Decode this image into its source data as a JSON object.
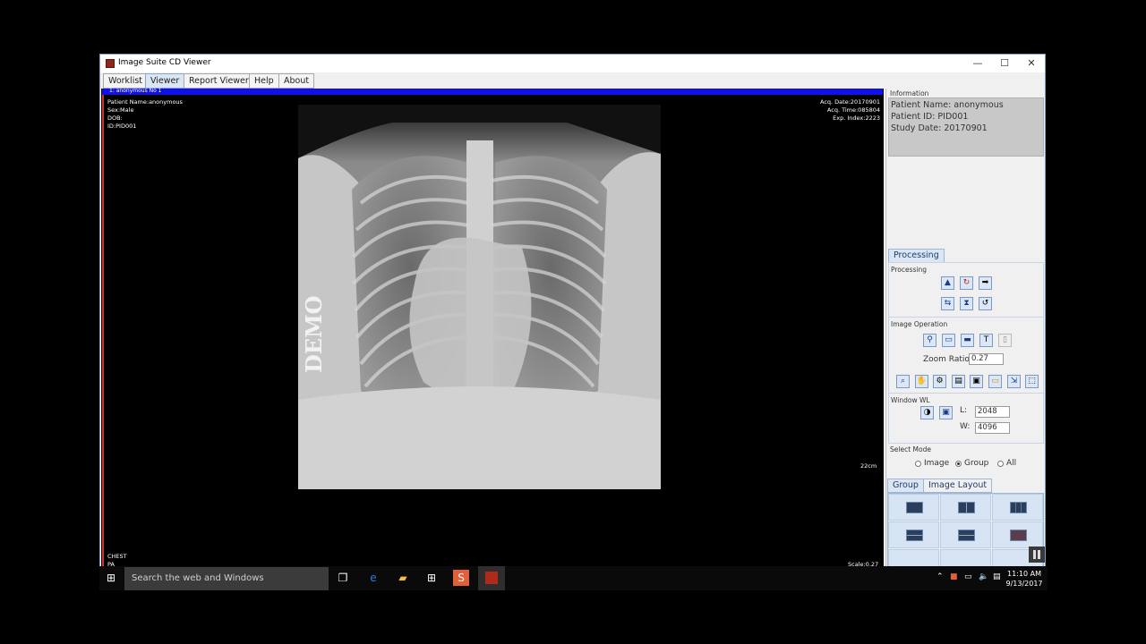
{
  "window": {
    "title": "Image Suite CD Viewer",
    "minimize": "—",
    "maximize": "☐",
    "close": "✕"
  },
  "menu": {
    "items": [
      "Worklist",
      "Viewer",
      "Report Viewer",
      "Help",
      "About"
    ],
    "active": "Viewer"
  },
  "viewer": {
    "header": "1: anonymous  No 1",
    "top_left": [
      "Patient Name:anonymous",
      "Sex:Male",
      "DOB:",
      "ID:PID001"
    ],
    "top_right": [
      "Acq. Date:20170901",
      "Acq. Time:085804",
      "Exp. Index:2223"
    ],
    "bottom_left": [
      "CHEST",
      "PA"
    ],
    "bottom_right": "Scale:0.27",
    "scale_mark": "22cm",
    "watermark": "DEMO"
  },
  "info": {
    "group_label": "Information",
    "patient_name": "Patient Name: anonymous",
    "patient_id": "Patient ID: PID001",
    "study_date": "Study Date: 20170901"
  },
  "processing": {
    "tab": "Processing",
    "group_label": "Processing",
    "tools_row1": [
      {
        "name": "pointer-icon",
        "glyph": "▲"
      },
      {
        "name": "rotate-icon",
        "glyph": "↻"
      },
      {
        "name": "arrow-right-icon",
        "glyph": "➡"
      }
    ],
    "tools_row2": [
      {
        "name": "flip-icon",
        "glyph": "⇆"
      },
      {
        "name": "invert-icon",
        "glyph": "⧗"
      },
      {
        "name": "reset-icon",
        "glyph": "↺"
      }
    ]
  },
  "image_operation": {
    "group_label": "Image Operation",
    "zoom_label": "Zoom Ratio",
    "zoom_value": "0.27",
    "tools_row1": [
      {
        "name": "zoom-icon",
        "glyph": "⚲"
      },
      {
        "name": "fit-width-icon",
        "glyph": "▭"
      },
      {
        "name": "fit-window-icon",
        "glyph": "▬"
      },
      {
        "name": "text-overlay-icon",
        "glyph": "T"
      },
      {
        "name": "clipboard-icon",
        "glyph": "▯"
      }
    ],
    "tools_row2": [
      {
        "name": "magnifier-icon",
        "glyph": "⌕"
      },
      {
        "name": "pan-hand-icon",
        "glyph": "✋"
      },
      {
        "name": "settings-icon",
        "glyph": "⚙"
      },
      {
        "name": "report-icon",
        "glyph": "▤"
      },
      {
        "name": "save-icon",
        "glyph": "▣"
      },
      {
        "name": "ruler-icon",
        "glyph": "▭"
      },
      {
        "name": "export-icon",
        "glyph": "⇲"
      },
      {
        "name": "select-region-icon",
        "glyph": "⬚"
      }
    ]
  },
  "window_wl": {
    "group_label": "Window WL",
    "l_label": "L:",
    "l_value": "2048",
    "w_label": "W:",
    "w_value": "4096"
  },
  "select_mode": {
    "group_label": "Select Mode",
    "options": [
      "Image",
      "Group",
      "All"
    ],
    "selected": "Group"
  },
  "layout_tabs": [
    "Group",
    "Image Layout"
  ],
  "taskbar": {
    "search_placeholder": "Search the web and Windows",
    "time": "11:10 AM",
    "date": "9/13/2017"
  }
}
